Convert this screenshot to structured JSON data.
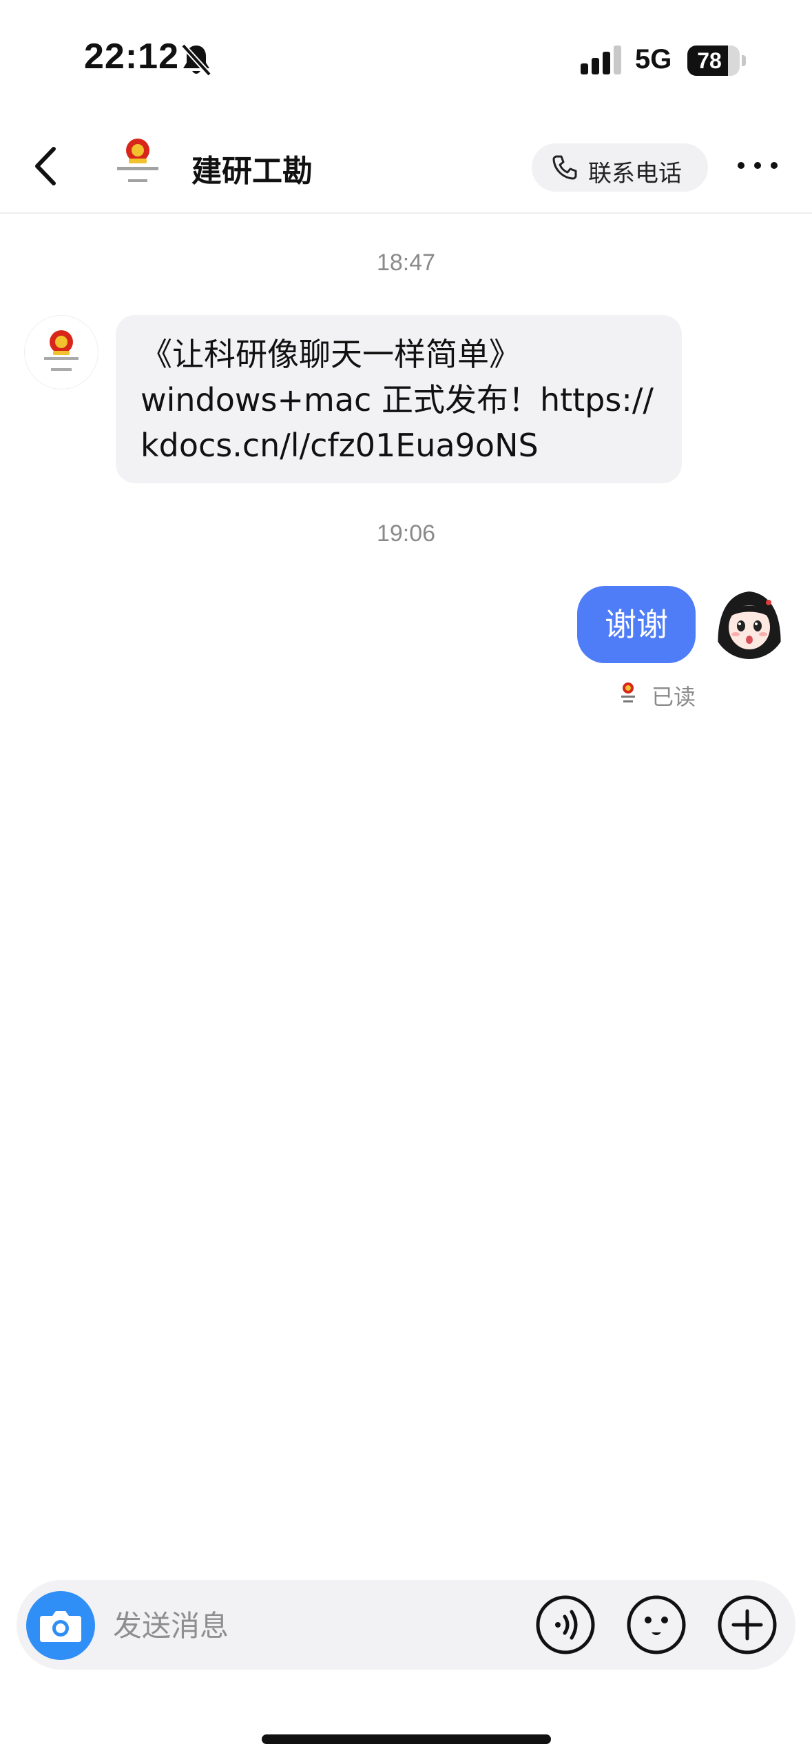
{
  "status_bar": {
    "time": "22:12",
    "network": "5G",
    "battery_level": "78",
    "battery_fraction": 0.78
  },
  "header": {
    "title": "建研工勘",
    "contact_phone_label": "联系电话",
    "avatar_caption": "建研工勘"
  },
  "messages": [
    {
      "time": "18:47",
      "direction": "incoming",
      "text": "《让科研像聊天一样简单》\nwindows+mac 正式发布！https://\nkdocs.cn/l/cfz01Eua9oNS"
    },
    {
      "time": "19:06",
      "direction": "outgoing",
      "text": "谢谢",
      "status": "已读"
    }
  ],
  "composer": {
    "placeholder": "发送消息"
  },
  "colors": {
    "accent": "#4f7cf7",
    "camera": "#2f8ff6",
    "bubble_incoming": "#f2f2f4",
    "emblem_red": "#d8261b",
    "emblem_gold": "#f2c12e"
  },
  "icons": [
    "bell-off-icon",
    "signal-icon",
    "battery-icon",
    "back-chevron-icon",
    "phone-icon",
    "more-icon",
    "camera-icon",
    "voice-icon",
    "emoji-icon",
    "plus-icon"
  ]
}
